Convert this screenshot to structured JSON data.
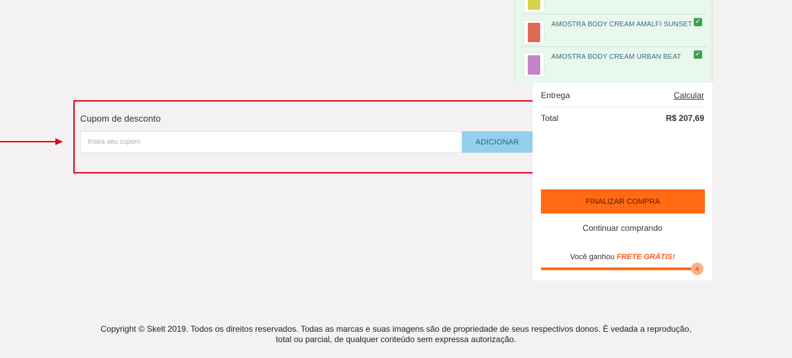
{
  "coupon": {
    "title": "Cupom de desconto",
    "placeholder": "Insira seu cupom",
    "value": "",
    "button_label": "ADICIONAR"
  },
  "cart": {
    "items": [
      {
        "name": "",
        "thumb_color": "#d6d44a",
        "checked": false
      },
      {
        "name": "AMOSTRA BODY CREAM AMALFI SUNSET",
        "thumb_color": "#e06a5a",
        "checked": true
      },
      {
        "name": "AMOSTRA BODY CREAM URBAN BEAT",
        "thumb_color": "#c484c8",
        "checked": true
      }
    ]
  },
  "summary": {
    "delivery_label": "Entrega",
    "delivery_action": "Calcular",
    "total_label": "Total",
    "total_value": "R$ 207,69",
    "finalize_label": "FINALIZAR COMPRA",
    "continue_label": "Continuar comprando",
    "shipping_prefix": "Você ganhou",
    "shipping_highlight": "FRETE GRÁTIS!",
    "shipping_progress": 1.0
  },
  "footer": {
    "line1": "Copyright © Skelt 2019. Todos os direitos reservados. Todas as marcas e suas imagens são de propriedade de seus respectivos donos. É vedada a reprodução,",
    "line2": "total ou parcial, de qualquer conteúdo sem expressa autorização."
  },
  "colors": {
    "annotation": "#e30613",
    "accent": "#ff6a13",
    "coupon_button": "#94d0ec"
  }
}
